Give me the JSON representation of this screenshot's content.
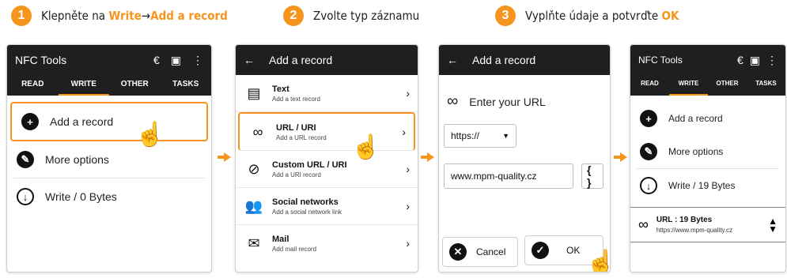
{
  "steps": [
    {
      "num": "1",
      "pre": "Klepněte na ",
      "hl1": "Write",
      "mid": "→",
      "hl2": "Add a record"
    },
    {
      "num": "2",
      "text": "Zvolte typ záznamu"
    },
    {
      "num": "3",
      "pre": "Vyplňte údaje a potvrďte ",
      "hl": "OK"
    }
  ],
  "accent": "#f7941d",
  "panel1": {
    "title": "NFC Tools",
    "tabs": [
      "READ",
      "WRITE",
      "OTHER",
      "TASKS"
    ],
    "items": [
      "Add a record",
      "More options",
      "Write / 0 Bytes"
    ]
  },
  "panel2": {
    "title": "Add a record",
    "records": [
      {
        "title": "Text",
        "sub": "Add a text record"
      },
      {
        "title": "URL / URI",
        "sub": "Add a URL record"
      },
      {
        "title": "Custom URL / URI",
        "sub": "Add a URI record"
      },
      {
        "title": "Social networks",
        "sub": "Add a social network link"
      },
      {
        "title": "Mail",
        "sub": "Add mail record"
      }
    ]
  },
  "panel3": {
    "title": "Add a record",
    "heading": "Enter your URL",
    "scheme": "https://",
    "url": "www.mpm-quality.cz",
    "braces": "{ }",
    "cancel": "Cancel",
    "ok": "OK"
  },
  "panel4": {
    "title": "NFC Tools",
    "tabs": [
      "READ",
      "WRITE",
      "OTHER",
      "TASKS"
    ],
    "items": [
      "Add a record",
      "More options",
      "Write / 19 Bytes"
    ],
    "record_title": "URL : 19 Bytes",
    "record_url": "https://www.mpm-quality.cz"
  }
}
